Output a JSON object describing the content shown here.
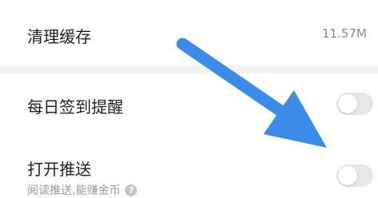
{
  "settings": {
    "clear_cache": {
      "label": "清理缓存",
      "value": "11.57M"
    },
    "daily_signin_reminder": {
      "label": "每日签到提醒",
      "enabled": false
    },
    "enable_push": {
      "label": "打开推送",
      "sub_label": "阅读推送,能赚金币",
      "enabled": false
    }
  },
  "icons": {
    "help": "question-circle-icon",
    "annotation_arrow": "arrow-icon"
  },
  "colors": {
    "arrow": "#3b8be8",
    "toggle_off": "#e6e6e6",
    "divider_band": "#f2f2f2"
  }
}
